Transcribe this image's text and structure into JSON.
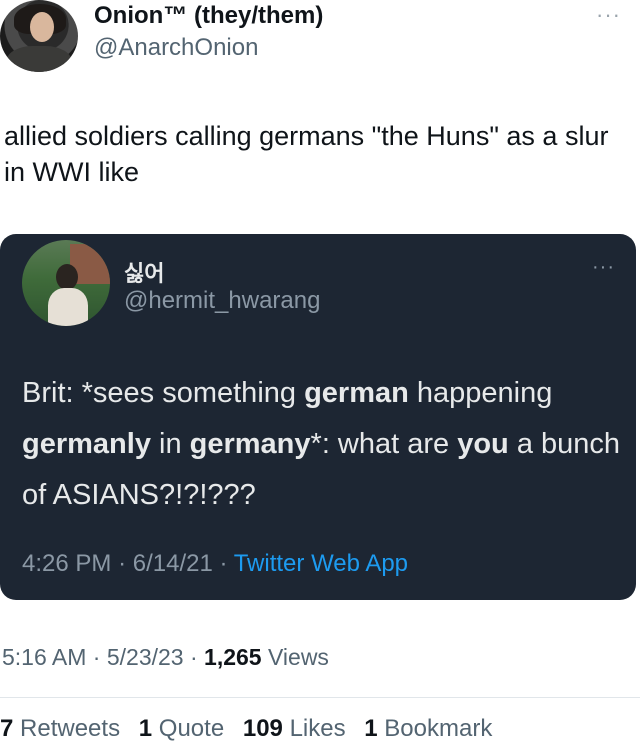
{
  "tweet": {
    "author_name": "Onion™ (they/them)",
    "author_handle": "@AnarchOnion",
    "more_icon": "more-horizontal-icon",
    "more_label": "···",
    "text": "allied soldiers calling germans \"the Huns\" as a slur in WWI like",
    "time": "5:16 AM",
    "date": "5/23/23",
    "views_count": "1,265",
    "views_label": "Views",
    "sep": "·"
  },
  "quote": {
    "author_name": "싫어",
    "author_handle": "@hermit_hwarang",
    "more_label": "···",
    "text_parts": [
      "Brit: *sees something ",
      "german",
      " happening ",
      "germanly",
      " in ",
      "germany",
      "*: what are ",
      "you",
      " a bunch of ASIANS?!?!???"
    ],
    "time": "4:26 PM",
    "date": "6/14/21",
    "app": "Twitter Web App",
    "sep": "·",
    "card_color": "#1d2633",
    "link_color": "#1d9bf0"
  },
  "stats": {
    "retweets_count": "7",
    "retweets_label": "Retweets",
    "quotes_count": "1",
    "quotes_label": "Quote",
    "likes_count": "109",
    "likes_label": "Likes",
    "bookmarks_count": "1",
    "bookmarks_label": "Bookmark"
  }
}
